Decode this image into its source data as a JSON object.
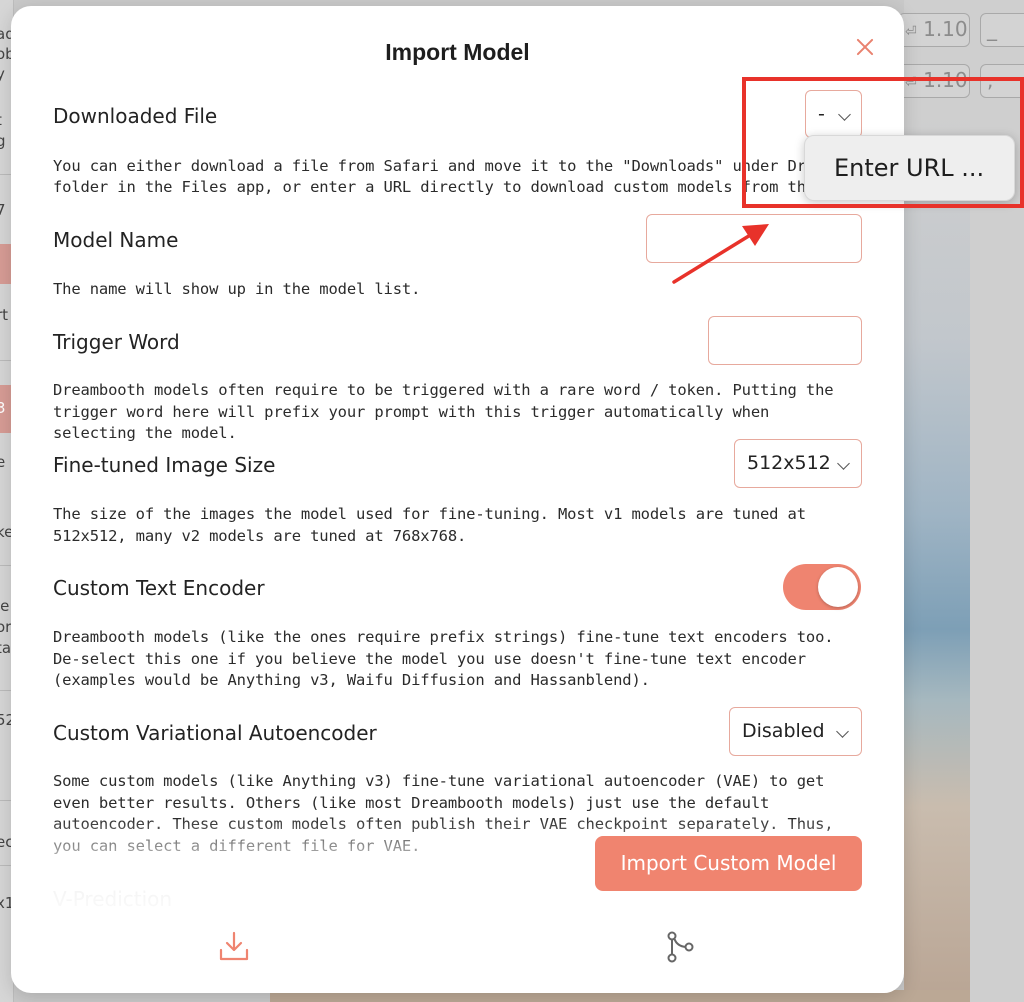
{
  "background": {
    "left_fragments": [
      "ad",
      "ob",
      "y",
      "t",
      "g",
      "7",
      "rt",
      "3",
      "e",
      "ke",
      "le",
      "or",
      "ta",
      "52",
      "ec",
      "x1"
    ],
    "right_chips": [
      "1.10",
      "_",
      "1.10",
      ", "
    ]
  },
  "modal": {
    "title": "Import Model",
    "close_icon": "close-icon",
    "import_button_label": "Import Custom Model",
    "partial_label": "V-Prediction",
    "bottom_icons": [
      "download-icon",
      "git-branch-icon"
    ]
  },
  "fields": {
    "downloaded_file": {
      "label": "Downloaded File",
      "value": "-",
      "description_line1": "You can either download a file from Safari and move it to the \"Downloads\" under Draw Things",
      "description_line2": "folder in the Files app, or enter a URL directly to download custom models from the internet."
    },
    "model_name": {
      "label": "Model Name",
      "value": "",
      "description": "The name will show up in the model list."
    },
    "trigger_word": {
      "label": "Trigger Word",
      "value": "",
      "description": "Dreambooth models often require to be triggered with a rare word / token. Putting the trigger word here will prefix your prompt with this trigger automatically when selecting the model."
    },
    "image_size": {
      "label": "Fine-tuned Image Size",
      "value": "512x512",
      "description": "The size of the images the model used for fine-tuning. Most v1 models are tuned at 512x512, many v2 models are tuned at 768x768."
    },
    "text_encoder": {
      "label": "Custom Text Encoder",
      "enabled": true,
      "description": "Dreambooth models (like the ones require prefix strings) fine-tune text encoders too. De-select this one if you believe the model you use doesn't fine-tune text encoder (examples would be Anything v3, Waifu Diffusion and Hassanblend)."
    },
    "vae": {
      "label": "Custom Variational Autoencoder",
      "value": "Disabled",
      "description": "Some custom models (like Anything v3) fine-tune variational autoencoder (VAE) to get even better results. Others (like most Dreambooth models) just use the default autoencoder. These custom models often publish their VAE checkpoint separately. Thus, you can select a different file for VAE."
    }
  },
  "popover": {
    "item": "Enter URL ..."
  },
  "colors": {
    "accent": "#f0846f",
    "annotation": "#e8322a",
    "input_border": "#e7a99d"
  }
}
